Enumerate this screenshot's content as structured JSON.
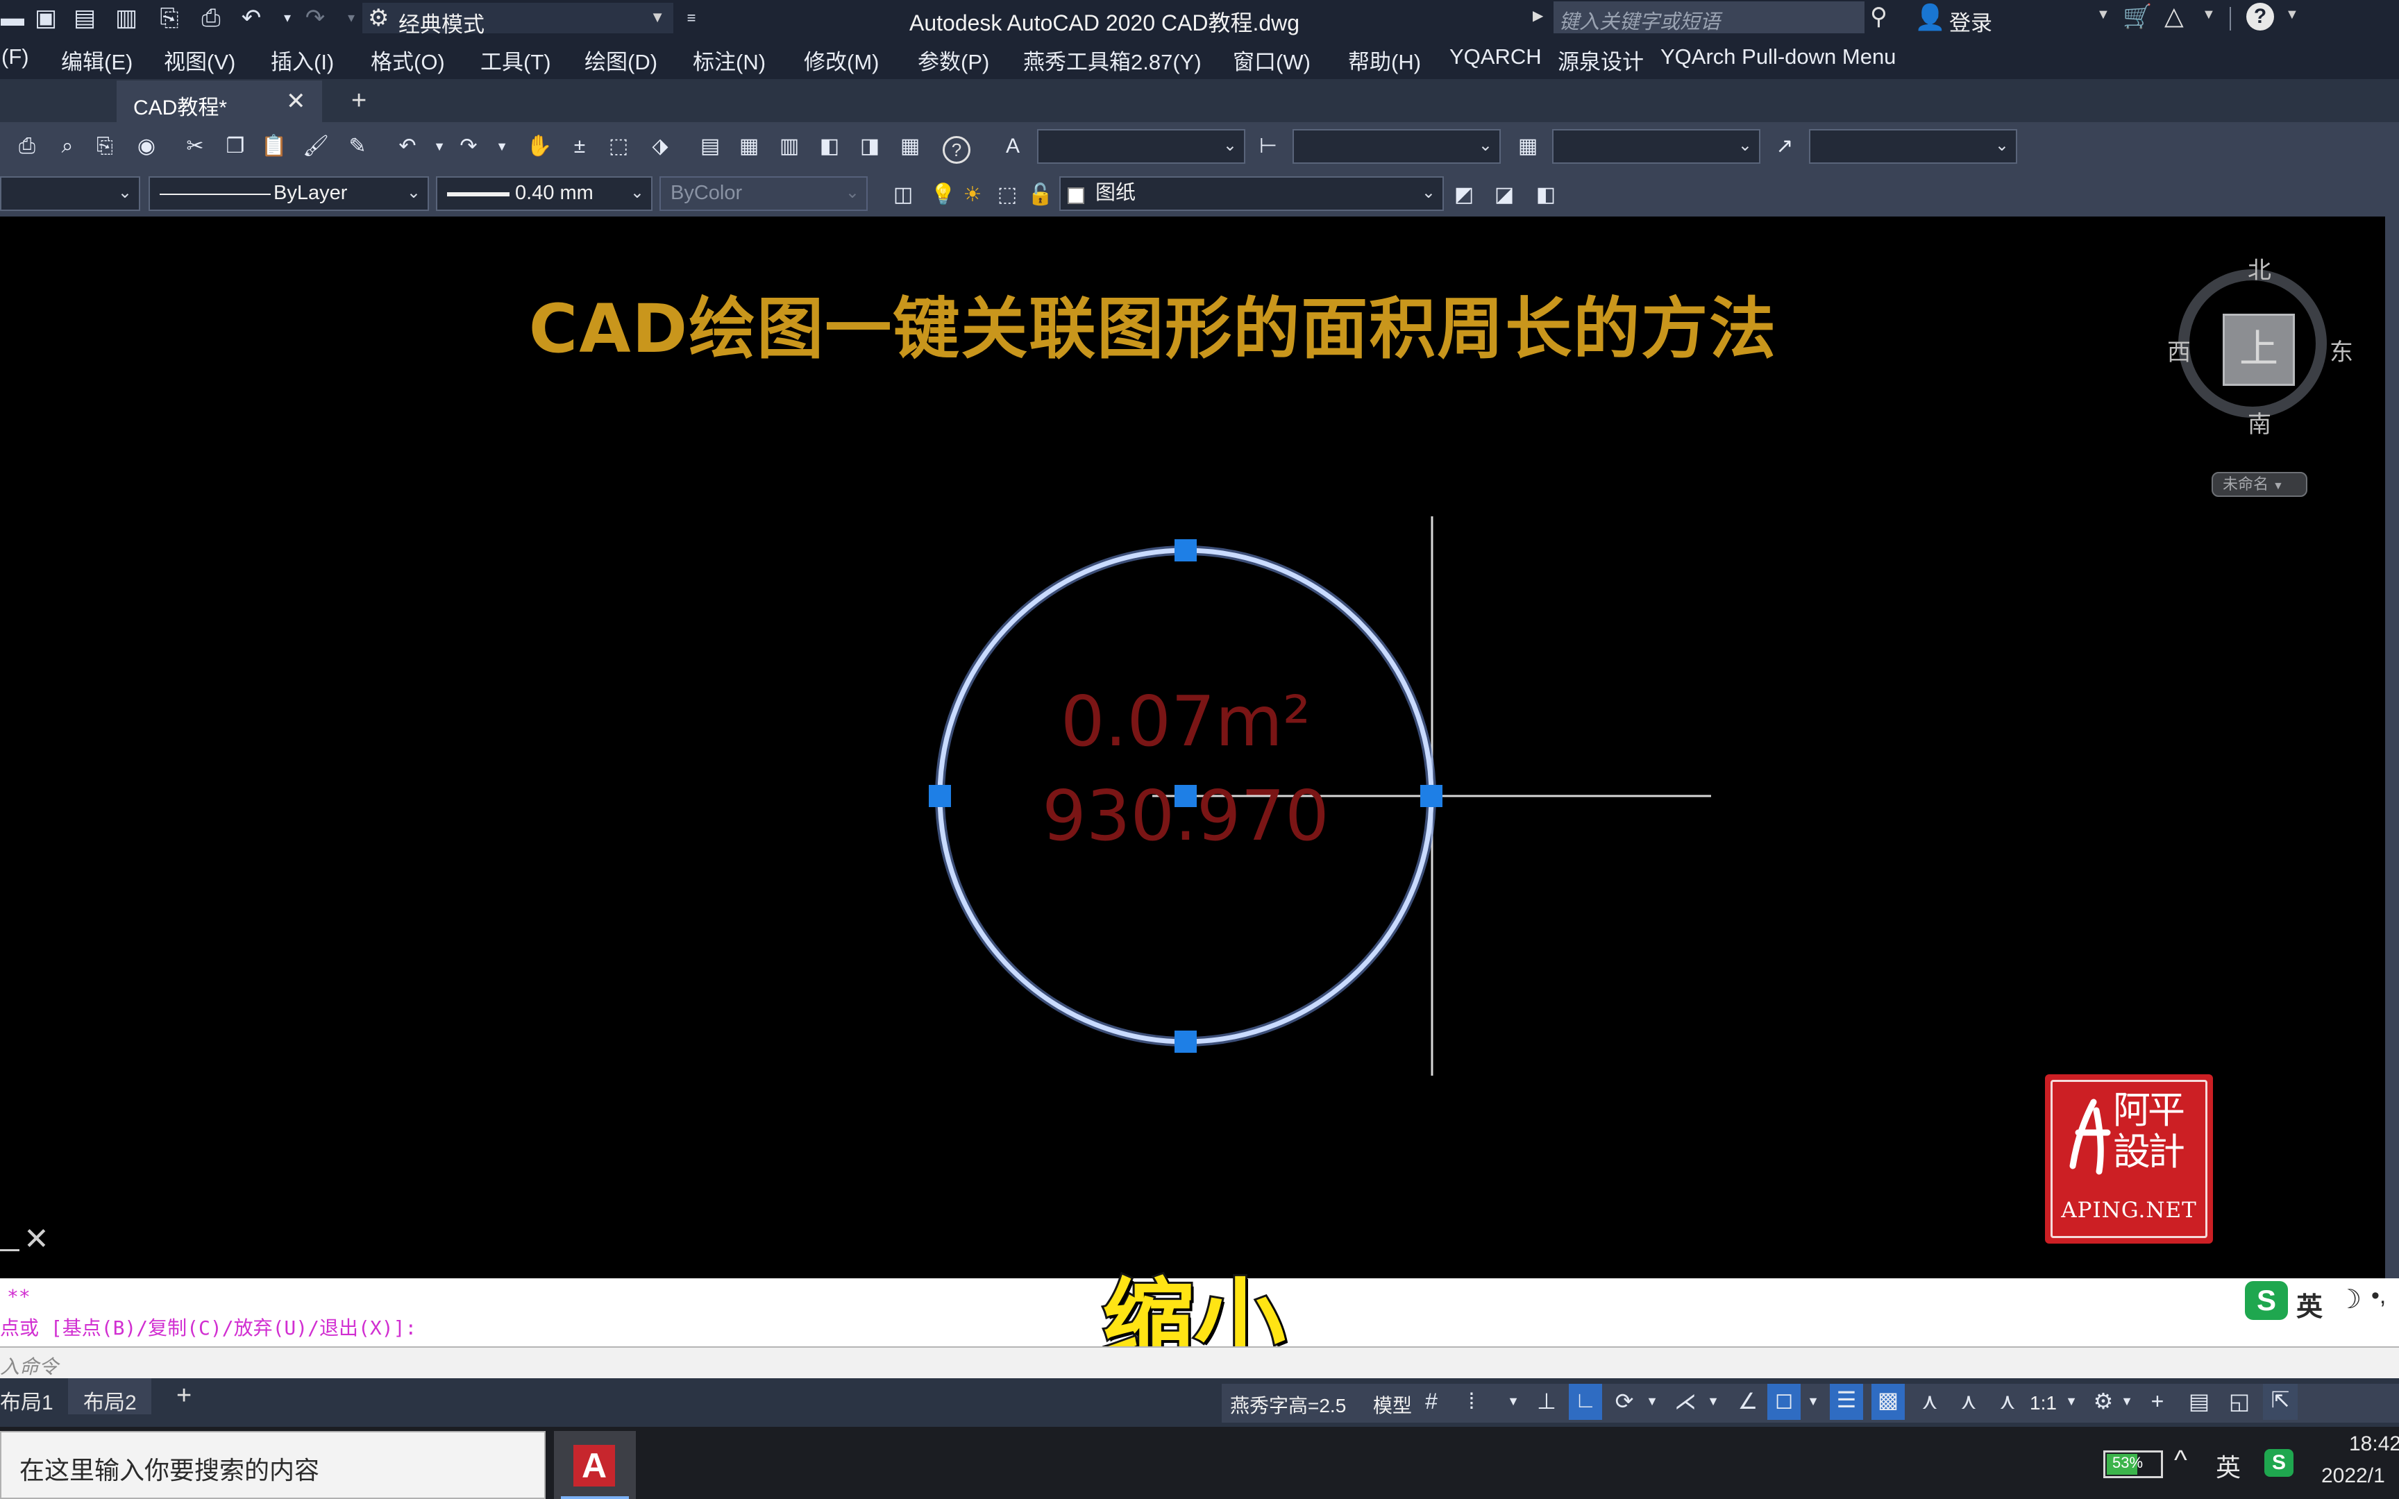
{
  "titlebar": {
    "workspace": "经典模式",
    "title": "Autodesk AutoCAD 2020    CAD教程.dwg",
    "search_placeholder": "键入关键字或短语",
    "login": "登录"
  },
  "menubar": {
    "items": [
      "(F)",
      "编辑(E)",
      "视图(V)",
      "插入(I)",
      "格式(O)",
      "工具(T)",
      "绘图(D)",
      "标注(N)",
      "修改(M)",
      "参数(P)",
      "燕秀工具箱2.87(Y)",
      "窗口(W)",
      "帮助(H)",
      "YQARCH",
      "源泉设计",
      "YQArch Pull-down Menu"
    ]
  },
  "tabs": {
    "active": "CAD教程*",
    "close": "✕",
    "add": "+"
  },
  "properties": {
    "linetype": "ByLayer",
    "lineweight": "0.40 mm",
    "plotstyle": "ByColor",
    "layer": "图纸"
  },
  "drawing": {
    "title_text": "CAD绘图一键关联图形的面积周长的方法",
    "area_label": "0.07m²",
    "perimeter_label": "930.970",
    "title_color": "#c9961c",
    "circle_color": "#a8c4ff",
    "grip_color": "#1e7fe6",
    "label_color": "#7a1515"
  },
  "viewcube": {
    "north": "北",
    "south": "南",
    "west": "西",
    "east": "东",
    "face": "上",
    "wcs": "未命名"
  },
  "seal": {
    "text": "APING.NET",
    "chars": "阿平設計"
  },
  "command": {
    "line1": "**",
    "line2": "点或 [基点(B)/复制(C)/放弃(U)/退出(X)]:",
    "placeholder": "入命令",
    "subtitle": "缩小"
  },
  "layouts": {
    "tabs": [
      "布局1",
      "布局2"
    ],
    "add": "+"
  },
  "statusbar": {
    "text_height": "燕秀字高=2.5",
    "model": "模型",
    "scale": "1:1"
  },
  "ime": {
    "lang": "英"
  },
  "taskbar": {
    "search": "在这里输入你要搜索的内容",
    "battery": "53%",
    "lang": "英",
    "time": "18:42",
    "date": "2022/1"
  }
}
